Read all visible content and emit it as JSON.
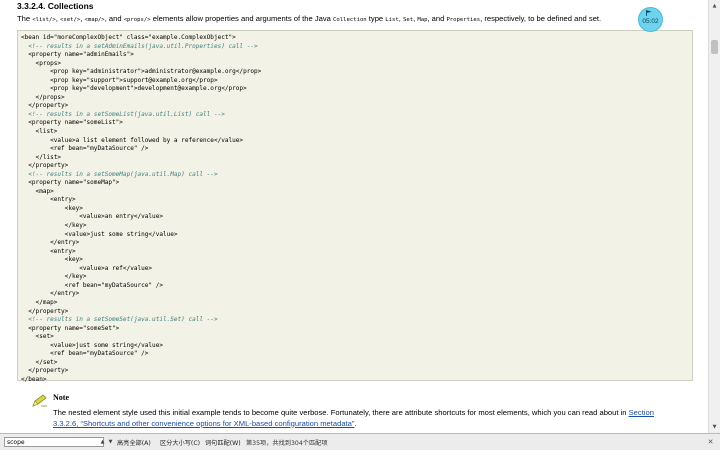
{
  "section": {
    "title": "3.3.2.4. Collections",
    "intro_parts": [
      "The ",
      "<list/>",
      ", ",
      "<set/>",
      ", ",
      "<map/>",
      ", and ",
      "<props/>",
      " elements allow properties and arguments of the Java ",
      "Collection",
      " type ",
      "List",
      ", ",
      "Set",
      ", ",
      "Map",
      ", and ",
      "Properties",
      ", respectively, to be defined and set."
    ]
  },
  "code_lines": [
    {
      "text": "<bean id=\"moreComplexObject\" class=\"example.ComplexObject\">",
      "comment": false
    },
    {
      "text": "  <!-- results in a setAdminEmails(java.util.Properties) call -->",
      "comment": true
    },
    {
      "text": "  <property name=\"adminEmails\">",
      "comment": false
    },
    {
      "text": "    <props>",
      "comment": false
    },
    {
      "text": "        <prop key=\"administrator\">administrator@example.org</prop>",
      "comment": false
    },
    {
      "text": "        <prop key=\"support\">support@example.org</prop>",
      "comment": false
    },
    {
      "text": "        <prop key=\"development\">development@example.org</prop>",
      "comment": false
    },
    {
      "text": "    </props>",
      "comment": false
    },
    {
      "text": "  </property>",
      "comment": false
    },
    {
      "text": "  <!-- results in a setSomeList(java.util.List) call -->",
      "comment": true
    },
    {
      "text": "  <property name=\"someList\">",
      "comment": false
    },
    {
      "text": "    <list>",
      "comment": false
    },
    {
      "text": "        <value>a list element followed by a reference</value>",
      "comment": false
    },
    {
      "text": "        <ref bean=\"myDataSource\" />",
      "comment": false
    },
    {
      "text": "    </list>",
      "comment": false
    },
    {
      "text": "  </property>",
      "comment": false
    },
    {
      "text": "  <!-- results in a setSomeMap(java.util.Map) call -->",
      "comment": true
    },
    {
      "text": "  <property name=\"someMap\">",
      "comment": false
    },
    {
      "text": "    <map>",
      "comment": false
    },
    {
      "text": "        <entry>",
      "comment": false
    },
    {
      "text": "            <key>",
      "comment": false
    },
    {
      "text": "                <value>an entry</value>",
      "comment": false
    },
    {
      "text": "            </key>",
      "comment": false
    },
    {
      "text": "            <value>just some string</value>",
      "comment": false
    },
    {
      "text": "        </entry>",
      "comment": false
    },
    {
      "text": "        <entry>",
      "comment": false
    },
    {
      "text": "            <key>",
      "comment": false
    },
    {
      "text": "                <value>a ref</value>",
      "comment": false
    },
    {
      "text": "            </key>",
      "comment": false
    },
    {
      "text": "            <ref bean=\"myDataSource\" />",
      "comment": false
    },
    {
      "text": "        </entry>",
      "comment": false
    },
    {
      "text": "    </map>",
      "comment": false
    },
    {
      "text": "  </property>",
      "comment": false
    },
    {
      "text": "  <!-- results in a setSomeSet(java.util.Set) call -->",
      "comment": true
    },
    {
      "text": "  <property name=\"someSet\">",
      "comment": false
    },
    {
      "text": "    <set>",
      "comment": false
    },
    {
      "text": "        <value>just some string</value>",
      "comment": false
    },
    {
      "text": "        <ref bean=\"myDataSource\" />",
      "comment": false
    },
    {
      "text": "    </set>",
      "comment": false
    },
    {
      "text": "  </property>",
      "comment": false
    },
    {
      "text": "</bean>",
      "comment": false
    }
  ],
  "note": {
    "title": "Note",
    "body_before": "The nested element style used this initial example tends to become quite verbose. Fortunately, there are attribute shortcuts for most elements, which you can read about in ",
    "link_text": "Section 3.3.2.6, “Shortcuts and other convenience options for XML-based configuration metadata”",
    "body_after": "."
  },
  "timer": {
    "value": "05:02"
  },
  "find_bar": {
    "query": "scope",
    "highlight_all_label": "高亮全部(A)",
    "match_case_label": "区分大小写(C)",
    "whole_word_label": "词句匹配(W)",
    "status": "第35项，共找到304个匹配项"
  },
  "colors": {
    "link": "#1c4ea3",
    "code_background": "#f2f2e6",
    "code_comment": "#3f7f7f",
    "timer_badge": "#6fd3ee"
  },
  "icons": {
    "note": "pencil-icon",
    "timer_flag": "flag-icon",
    "find_previous": "triangle-up-icon",
    "find_next": "triangle-down-icon",
    "find_close": "close-icon"
  }
}
